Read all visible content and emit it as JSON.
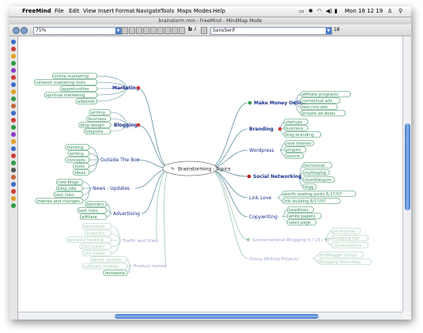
{
  "menubar": {
    "app": "FreeMind",
    "items": [
      "File",
      "Edit",
      "View",
      "Insert",
      "Format",
      "Navigate",
      "Tools",
      "Maps",
      "Modes",
      "Help"
    ],
    "clock": "Mon 18 12 19"
  },
  "window": {
    "title": "brainstorm.mm - FreeMind - MindMap Mode"
  },
  "toolbar": {
    "zoom": "75%",
    "font": "SansSerif",
    "font_size": "18"
  },
  "mindmap": {
    "root": "Brainstorming - Topics",
    "right_topics": {
      "online": "Make Money Online",
      "branding": "Branding",
      "wordpress": "Wordpress",
      "social": "Social Networking",
      "linklove": "Link Love",
      "copywriting": "Copywriting",
      "blogging_tips": "Conversational Blogging 6 / 15 / 07",
      "group": "Group Writing Projects"
    },
    "left_topics": {
      "marketing": "Marketing",
      "blogging": "Blogging",
      "outside": "Outside The Box",
      "news": "News - Updates",
      "advertising": "Advertising",
      "traffic": "Traffic and Stats",
      "review": "Product review"
    },
    "right_leaves": {
      "online": [
        "affiliate programs",
        "contextual ads",
        "text-link-ads",
        "private ad deals"
      ],
      "branding": [
        "startups",
        "business",
        "blog branding"
      ],
      "wordpress": [
        "new themes",
        "plugins",
        "source"
      ],
      "social": [
        "technorati",
        "mybloglog",
        "stumbleupon",
        "digg"
      ],
      "linklove": [
        "worth reading posts 6/17/07",
        "link building 6/17/07"
      ],
      "copywriting": [
        "headlines",
        "white papers",
        "sales page"
      ],
      "blogging_tips": [
        "permission",
        "blogging tips",
        "conversations"
      ],
      "group": [
        "ProBlogger Group",
        "Blogging Interviews"
      ]
    },
    "left_leaves": {
      "marketing": [
        "online marketing",
        "network marketing tools",
        "opportunities",
        "spiritual marketing",
        "adwords"
      ],
      "blogging": [
        "writing",
        "business",
        "blog design",
        "blogrolls"
      ],
      "outside": [
        "thinking",
        "writing",
        "concepts",
        "tools",
        "ideas"
      ],
      "news": [
        "new blogs",
        "blog jobs",
        "text links",
        "memes and changes"
      ],
      "advertising": [
        "banners",
        "text links",
        "affiliate"
      ],
      "traffic": [
        "technorati",
        "analytics",
        "keyword tracking",
        "statcounter",
        "site meter"
      ],
      "review": [
        "ebook reviews",
        "software reviews",
        "reviewme"
      ]
    }
  },
  "colors": {
    "topic": "#1a2f8e",
    "leaf": "#2e8b57",
    "edge": "#5a8fa0",
    "faded": "#9fc8b4"
  }
}
